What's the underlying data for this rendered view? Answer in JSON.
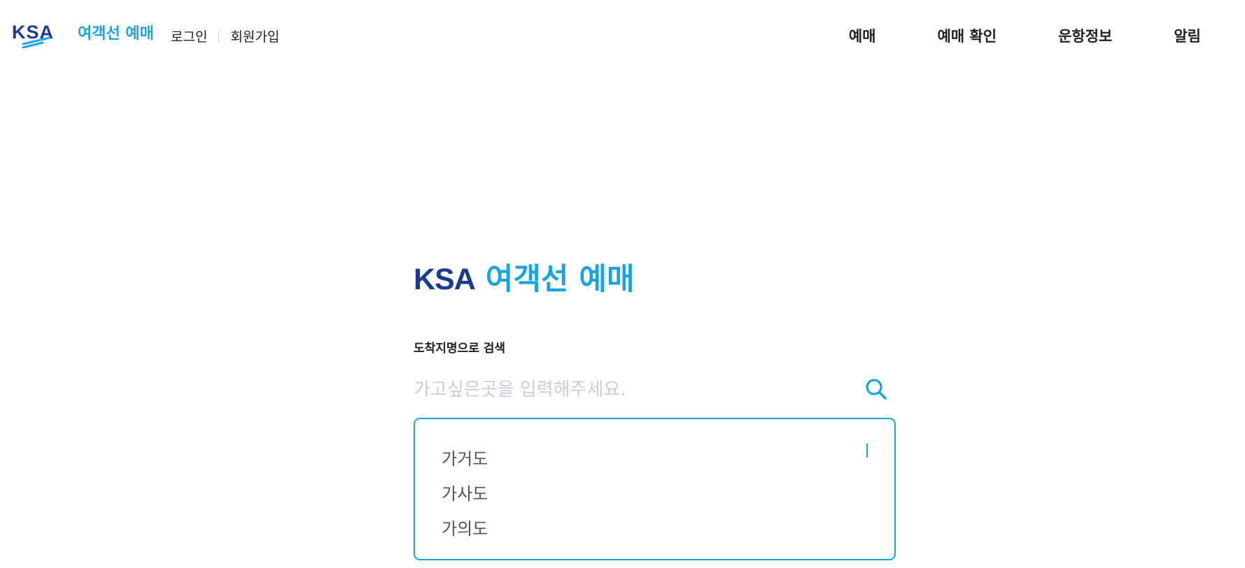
{
  "header": {
    "logo_mark": "KSA",
    "logo_text": "여객선 예매",
    "login_label": "로그인",
    "signup_label": "회원가입",
    "nav": [
      {
        "label": "예매"
      },
      {
        "label": "예매 확인"
      },
      {
        "label": "운항정보"
      },
      {
        "label": "알림"
      }
    ]
  },
  "main": {
    "title_brand": "KSA",
    "title_service": "여객선 예매",
    "search_label": "도착지명으로 검색",
    "search_placeholder": "가고싶은곳을 입력해주세요.",
    "search_value": "",
    "search_icon": "search-icon"
  },
  "suggestions": [
    {
      "label": "가거도"
    },
    {
      "label": "가사도"
    },
    {
      "label": "가의도"
    }
  ],
  "colors": {
    "brand_navy": "#1e3a8a",
    "accent_blue": "#1aa3dd",
    "placeholder_gray": "#c8ced8",
    "suggestion_text": "#4a5565"
  }
}
